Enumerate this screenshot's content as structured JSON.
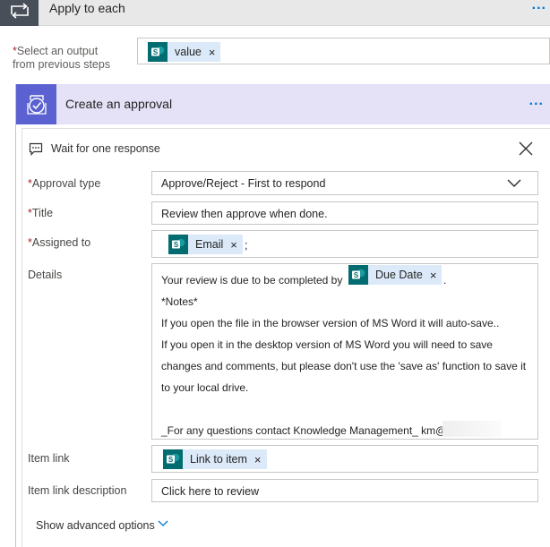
{
  "loop": {
    "title": "Apply to each",
    "more": "...",
    "output_label_line1": "Select an output",
    "output_label_line2": "from previous steps",
    "output_token": "value"
  },
  "approval": {
    "title": "Create an approval",
    "more": "...",
    "subtitle": "Wait for one response",
    "fields": {
      "approval_type_label": "Approval type",
      "approval_type_value": "Approve/Reject - First to respond",
      "title_label": "Title",
      "title_value": "Review then approve when done.",
      "assigned_label": "Assigned to",
      "assigned_token": "Email",
      "assigned_suffix": ";",
      "details_label": "Details",
      "details_prefix": "Your review is due to be completed by",
      "details_token": "Due Date",
      "details_suffix": ".",
      "details_lines": [
        "*Notes*",
        "If you open the file in the browser version of MS Word it will  auto-save..",
        "If you open it in the desktop version of MS Word you will need to save",
        "changes and comments, but please don't use the 'save as' function to save it",
        "to your local drive.",
        "_For any questions contact Knowledge Management_ km@"
      ],
      "item_link_label": "Item link",
      "item_link_token": "Link to item",
      "item_link_desc_label": "Item link description",
      "item_link_desc_value": "Click here to review"
    },
    "advanced": "Show advanced options"
  },
  "token_close": "×",
  "required_mark": "*",
  "colors": {
    "accent": "#0078d4",
    "approval_icon": "#5b61d1",
    "approval_header": "#e5e1f7",
    "sharepoint": "#036c70",
    "token_bg": "#dbe9f9"
  },
  "icons": {
    "loop": "loop-icon",
    "approval": "approval-icon",
    "wait": "message-icon",
    "close": "close-icon",
    "dropdown": "chevron-down-icon",
    "sharepoint": "sharepoint-icon"
  }
}
